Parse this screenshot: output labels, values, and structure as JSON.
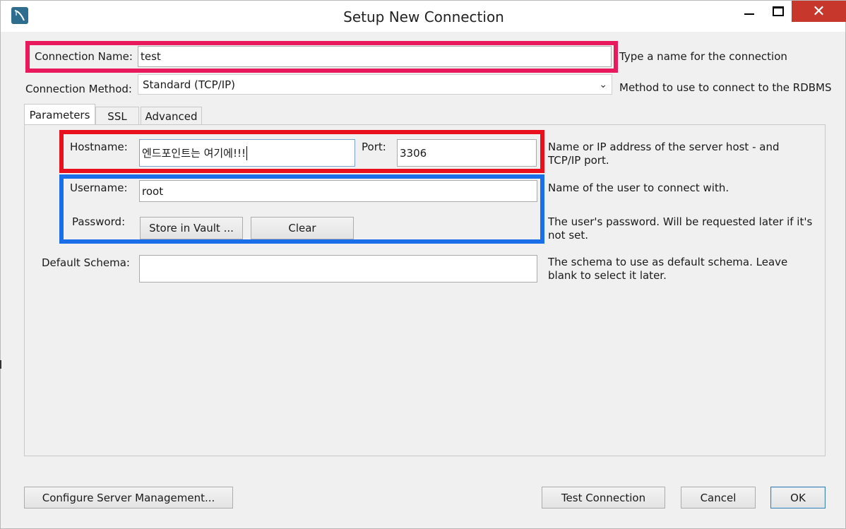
{
  "window": {
    "title": "Setup New Connection",
    "close_glyph": "✕"
  },
  "connection": {
    "name_label": "Connection Name:",
    "name_value": "test",
    "name_help": "Type a name for the connection",
    "method_label": "Connection Method:",
    "method_value": "Standard (TCP/IP)",
    "method_help": "Method to use to connect to the RDBMS"
  },
  "tabs": [
    {
      "label": "Parameters",
      "active": true
    },
    {
      "label": "SSL",
      "active": false
    },
    {
      "label": "Advanced",
      "active": false
    }
  ],
  "parameters": {
    "hostname_label": "Hostname:",
    "hostname_value": "엔드포인트는 여기에!!!",
    "port_label": "Port:",
    "port_value": "3306",
    "host_help_line1": "Name or IP address of the server host - and",
    "host_help_line2": "TCP/IP port.",
    "username_label": "Username:",
    "username_value": "root",
    "username_help": "Name of the user to connect with.",
    "password_label": "Password:",
    "store_vault_label": "Store in Vault ...",
    "clear_label": "Clear",
    "password_help_line1": "The user's password. Will be requested later if it's",
    "password_help_line2": "not set.",
    "schema_label": "Default Schema:",
    "schema_value": "",
    "schema_help_line1": "The schema to use as default schema. Leave",
    "schema_help_line2": "blank to select it later."
  },
  "footer": {
    "configure_label": "Configure Server Management...",
    "test_label": "Test Connection",
    "cancel_label": "Cancel",
    "ok_label": "OK"
  },
  "colors": {
    "highlight_connection": "#e9195d",
    "highlight_host": "#e8101d",
    "highlight_credentials": "#1a6ee8",
    "close_button": "#c7372b"
  }
}
